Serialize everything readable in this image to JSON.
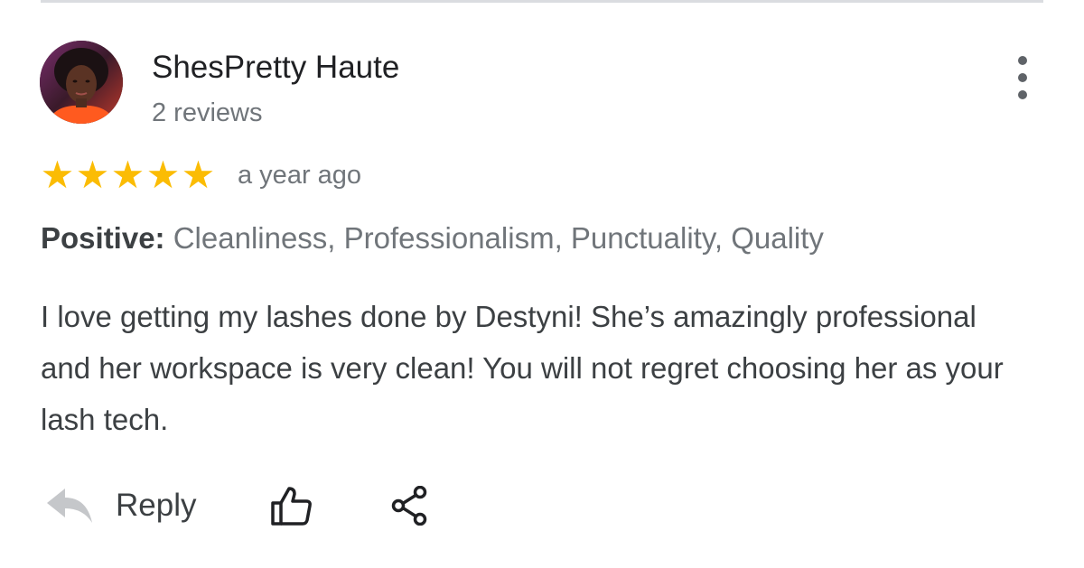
{
  "review": {
    "author": {
      "name": "ShesPretty Haute",
      "meta": "2 reviews",
      "avatar": "profile-photo"
    },
    "rating": {
      "stars": 5,
      "max": 5,
      "star_glyph": "★",
      "color": "#fbbc04"
    },
    "time": "a year ago",
    "attributes": {
      "label": "Positive:",
      "values": "Cleanliness, Professionalism, Punctuality, Quality"
    },
    "body": "I love getting my lashes done by Destyni! She’s amazingly professional and her workspace is very clean! You will not regret choosing her as your lash tech.",
    "actions": {
      "reply_label": "Reply",
      "reply_icon": "reply-arrow-icon",
      "like_icon": "thumbs-up-icon",
      "share_icon": "share-icon",
      "more_icon": "more-vertical-icon"
    }
  }
}
